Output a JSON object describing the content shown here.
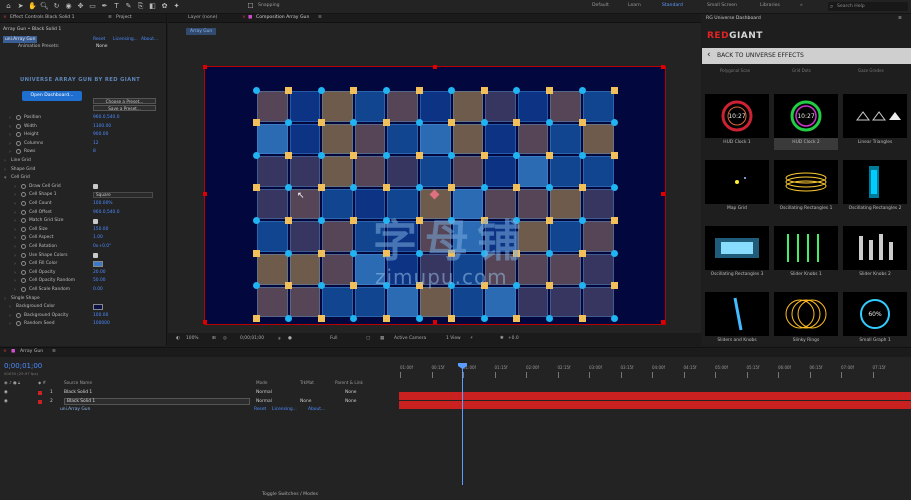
{
  "workspaces": {
    "default": "Default",
    "learn": "Learn",
    "standard": "Standard",
    "small_screen": "Small Screen",
    "libraries": "Libraries"
  },
  "search_placeholder": "Search Help",
  "snapping": "Snapping",
  "left_panel": {
    "tab_effect_controls": "Effect Controls Black Solid 1",
    "tab_project": "Project",
    "subheader": "Array Gun • Black Solid 1",
    "effect_name": "uni.Array Gun",
    "links": {
      "reset": "Reset",
      "licensing": "Licensing...",
      "about": "About..."
    },
    "animation_presets_label": "Animation Presets:",
    "animation_presets_value": "None",
    "brand_heading": "UNIVERSE ARRAY GUN BY RED GIANT",
    "open_dashboard": "Open Dashboard...",
    "choose_preset": "Choose a Preset...",
    "save_preset": "Save a Preset...",
    "properties": [
      {
        "label": "Position",
        "value": "960.0,540.0",
        "indent": 1,
        "sw": true
      },
      {
        "label": "Width",
        "value": "1300.00",
        "indent": 1,
        "sw": true
      },
      {
        "label": "Height",
        "value": "900.00",
        "indent": 1,
        "sw": true
      },
      {
        "label": "Columns",
        "value": "12",
        "indent": 1,
        "sw": true
      },
      {
        "label": "Rows",
        "value": "8",
        "indent": 1,
        "sw": true
      },
      {
        "label": "Line Grid",
        "value": "",
        "indent": 0,
        "sw": false
      },
      {
        "label": "Shape Grid",
        "value": "",
        "indent": 0,
        "sw": false
      },
      {
        "label": "Cell Grid",
        "value": "",
        "indent": 0,
        "sw": false,
        "open": true
      },
      {
        "label": "Draw Cell Grid",
        "value": "",
        "indent": 2,
        "sw": true,
        "check": true
      },
      {
        "label": "Cell Shape 1",
        "value": "Square",
        "indent": 2,
        "sw": true,
        "dropdown": true
      },
      {
        "label": "Cell Count",
        "value": "100.00%",
        "indent": 2,
        "sw": true
      },
      {
        "label": "Cell Offset",
        "value": "960.0,540.0",
        "indent": 2,
        "sw": true
      },
      {
        "label": "Match Grid Size",
        "value": "",
        "indent": 2,
        "sw": true,
        "check": true
      },
      {
        "label": "Cell Size",
        "value": "150.00",
        "indent": 2,
        "sw": true
      },
      {
        "label": "Cell Aspect",
        "value": "1.00",
        "indent": 2,
        "sw": true
      },
      {
        "label": "Cell Rotation",
        "value": "0x+0.0°",
        "indent": 2,
        "sw": true
      },
      {
        "label": "Use Shape Colors",
        "value": "",
        "indent": 2,
        "sw": true,
        "check": true
      },
      {
        "label": "Cell Fill Color",
        "value": "",
        "indent": 2,
        "sw": true,
        "swatch": "#3a78c8"
      },
      {
        "label": "Cell Opacity",
        "value": "20.00",
        "indent": 2,
        "sw": true
      },
      {
        "label": "Cell Opacity Random",
        "value": "50.00",
        "indent": 2,
        "sw": true
      },
      {
        "label": "Cell Scale Random",
        "value": "0.00",
        "indent": 2,
        "sw": true
      },
      {
        "label": "Single Shape",
        "value": "",
        "indent": 0,
        "sw": false
      },
      {
        "label": "Background Color",
        "value": "",
        "indent": 1,
        "sw": false,
        "swatch": "#0a1248"
      },
      {
        "label": "Background Opacity",
        "value": "100.00",
        "indent": 1,
        "sw": true
      },
      {
        "label": "Random Seed",
        "value": "100000",
        "indent": 1,
        "sw": true
      }
    ]
  },
  "viewer": {
    "tab_layer": "Layer (none)",
    "tab_comp": "Composition Array Gun",
    "comp_tag": "Array Gun",
    "zoom": "100%",
    "timecode": "0;00;01;00",
    "quality": "Full",
    "camera": "Active Camera",
    "view": "1 View",
    "exposure": "+0.0",
    "colors": {
      "bg": "#02083e",
      "dot": "#20b4f3",
      "square": "#f1c05a"
    }
  },
  "watermark": {
    "text": "字母铺",
    "url": "zimupu.com"
  },
  "right_panel": {
    "title": "RG Universe Dashboard",
    "brand_red": "RED",
    "brand_gray": "GIANT",
    "back_label": "BACK TO UNIVERSE EFFECTS",
    "partial_row": [
      "Polygonal Scan",
      "Grid Dots",
      "Gaze Grades"
    ],
    "cards": [
      {
        "label": "HUD Clock 1",
        "kind": "clock1"
      },
      {
        "label": "HUD Clock 2",
        "kind": "clock2",
        "selected": true
      },
      {
        "label": "Linear Triangles",
        "kind": "tri"
      },
      {
        "label": "Map Grid",
        "kind": "map"
      },
      {
        "label": "Oscillating Rectangles 1",
        "kind": "osc1"
      },
      {
        "label": "Oscillating Rectangles 2",
        "kind": "osc2"
      },
      {
        "label": "Oscillating Rectangles 3",
        "kind": "osc3"
      },
      {
        "label": "Slider Knobs 1",
        "kind": "knob1"
      },
      {
        "label": "Slider Knobs 2",
        "kind": "knob2"
      },
      {
        "label": "Sliders and Knobs",
        "kind": "sk"
      },
      {
        "label": "Slinky Rings",
        "kind": "slinky"
      },
      {
        "label": "Small Graph 1",
        "kind": "graph"
      }
    ]
  },
  "timeline": {
    "comp_tab": "Array Gun",
    "timecode": "0;00;01;00",
    "timecode_sub": "00030 (29.97 fps)",
    "columns": {
      "source": "Source Name",
      "mode": "Mode",
      "trkmat": "TrkMat",
      "parent": "Parent & Link"
    },
    "layers": [
      {
        "num": "1",
        "name": "Black Solid 1",
        "mode": "Normal",
        "trk": "",
        "parent": "None"
      },
      {
        "num": "2",
        "name": "Black Solid 1",
        "mode": "Normal",
        "trk": "None",
        "parent": "None"
      }
    ],
    "effect_row": {
      "name": "uni.Array Gun",
      "reset": "Reset",
      "licensing": "Licensing...",
      "about": "About..."
    },
    "ruler": [
      "01:00f",
      "00:15f",
      "01:00f",
      "01:15f",
      "02:00f",
      "02:15f",
      "03:00f",
      "03:15f",
      "04:00f",
      "04:15f",
      "05:00f",
      "05:15f",
      "06:00f",
      "06:15f",
      "07:00f",
      "07:15f"
    ],
    "toggle_label": "Toggle Switches / Modes"
  }
}
